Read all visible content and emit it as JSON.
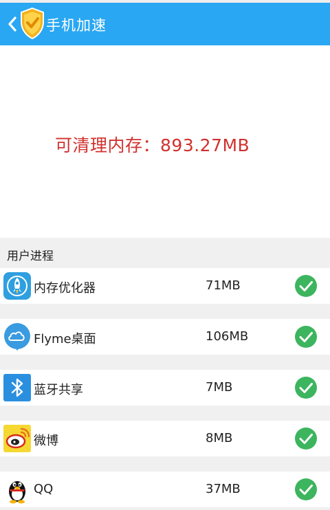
{
  "header": {
    "title": "手机加速",
    "back_icon": "chevron-left-icon",
    "logo_icon": "shield-check-icon",
    "color": "#2aa7f2"
  },
  "summary": {
    "label": "可清理内存：",
    "value": "893.27MB",
    "color": "#d0312d"
  },
  "section": {
    "title": "用户进程"
  },
  "processes": [
    {
      "name": "内存优化器",
      "size": "71MB",
      "icon": "rocket-icon",
      "checked": true
    },
    {
      "name": "Flyme桌面",
      "size": "106MB",
      "icon": "cloud-icon",
      "checked": true
    },
    {
      "name": "蓝牙共享",
      "size": "7MB",
      "icon": "bluetooth-icon",
      "checked": true
    },
    {
      "name": "微博",
      "size": "8MB",
      "icon": "weibo-icon",
      "checked": true
    },
    {
      "name": "QQ",
      "size": "37MB",
      "icon": "qq-penguin-icon",
      "checked": true
    }
  ],
  "check_color": "#3cb55e"
}
